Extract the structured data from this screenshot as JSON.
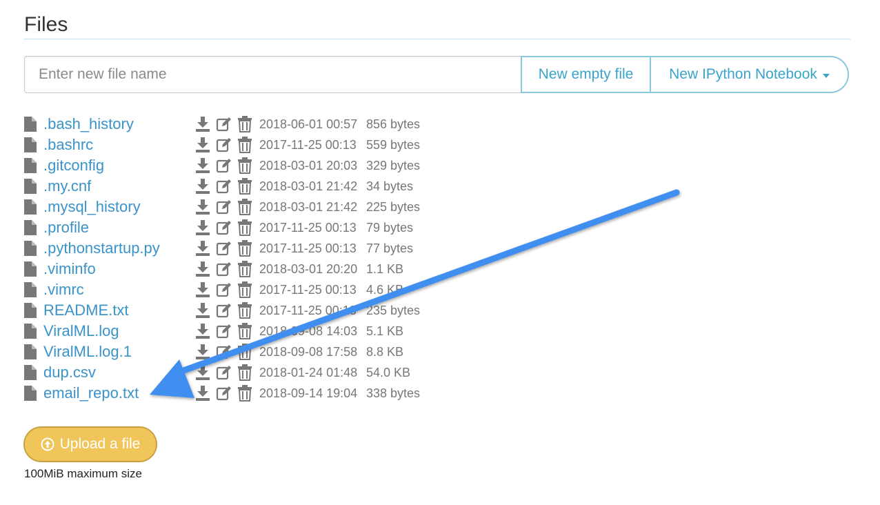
{
  "header": {
    "title": "Files"
  },
  "new_file": {
    "placeholder": "Enter new file name",
    "new_empty_file_label": "New empty file",
    "new_notebook_label": "New IPython Notebook"
  },
  "files": [
    {
      "name": ".bash_history",
      "date": "2018-06-01 00:57",
      "size": "856 bytes"
    },
    {
      "name": ".bashrc",
      "date": "2017-11-25 00:13",
      "size": "559 bytes"
    },
    {
      "name": ".gitconfig",
      "date": "2018-03-01 20:03",
      "size": "329 bytes"
    },
    {
      "name": ".my.cnf",
      "date": "2018-03-01 21:42",
      "size": "34 bytes"
    },
    {
      "name": ".mysql_history",
      "date": "2018-03-01 21:42",
      "size": "225 bytes"
    },
    {
      "name": ".profile",
      "date": "2017-11-25 00:13",
      "size": "79 bytes"
    },
    {
      "name": ".pythonstartup.py",
      "date": "2017-11-25 00:13",
      "size": "77 bytes"
    },
    {
      "name": ".viminfo",
      "date": "2018-03-01 20:20",
      "size": "1.1 KB"
    },
    {
      "name": ".vimrc",
      "date": "2017-11-25 00:13",
      "size": "4.6 KB"
    },
    {
      "name": "README.txt",
      "date": "2017-11-25 00:13",
      "size": "235 bytes"
    },
    {
      "name": "ViralML.log",
      "date": "2018-09-08 14:03",
      "size": "5.1 KB"
    },
    {
      "name": "ViralML.log.1",
      "date": "2018-09-08 17:58",
      "size": "8.8 KB"
    },
    {
      "name": "dup.csv",
      "date": "2018-01-24 01:48",
      "size": "54.0 KB"
    },
    {
      "name": "email_repo.txt",
      "date": "2018-09-14 19:04",
      "size": "338 bytes"
    }
  ],
  "icons": {
    "file": "file-icon",
    "download": "download-icon",
    "edit": "edit-icon",
    "delete": "trash-icon",
    "upload": "upload-circle-icon"
  },
  "colors": {
    "link": "#3a93c9",
    "button_accent": "#3aa3c8",
    "upload_button": "#f0c65a",
    "annotation_arrow": "#3f8ef0",
    "icon_gray": "#777777"
  },
  "upload": {
    "button_label": "Upload a file",
    "max_size_note": "100MiB maximum size"
  }
}
